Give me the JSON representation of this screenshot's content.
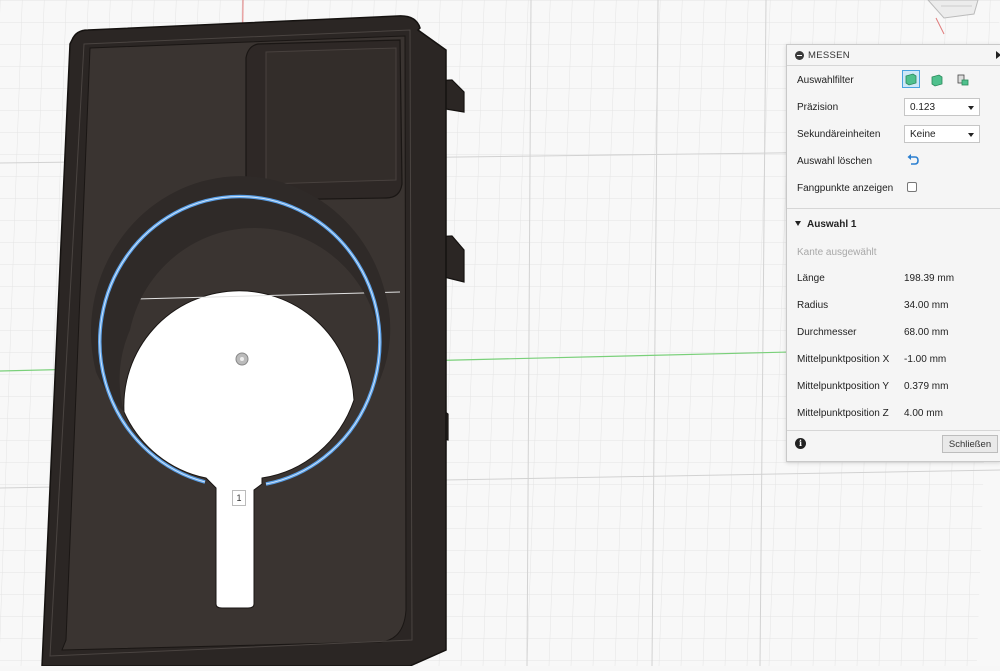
{
  "panel": {
    "title": "MESSEN",
    "filter_label": "Auswahlfilter",
    "precision_label": "Präzision",
    "precision_value": "0.123",
    "secondary_units_label": "Sekundäreinheiten",
    "secondary_units_value": "Keine",
    "clear_selection_label": "Auswahl löschen",
    "show_snap_points_label": "Fangpunkte anzeigen",
    "section_title": "Auswahl 1",
    "selected_info": "Kante ausgewählt",
    "measurements": [
      {
        "label": "Länge",
        "value": "198.39 mm"
      },
      {
        "label": "Radius",
        "value": "34.00 mm"
      },
      {
        "label": "Durchmesser",
        "value": "68.00 mm"
      },
      {
        "label": "Mittelpunktposition X",
        "value": "-1.00 mm"
      },
      {
        "label": "Mittelpunktposition Y",
        "value": "0.379 mm"
      },
      {
        "label": "Mittelpunktposition Z",
        "value": "4.00 mm"
      }
    ],
    "close_button": "Schließen",
    "info_icon": "i"
  },
  "viewport": {
    "point_label": "1",
    "axis_x_color": "#7ad07a",
    "axis_y_color": "#e07a7a",
    "selection_color": "#5aa0e8",
    "body_color": "#2b2624"
  },
  "icons": {
    "filter_body": "body-filter-icon",
    "filter_face": "face-filter-icon",
    "filter_edge": "edge-filter-icon",
    "undo": "undo-icon",
    "info": "info-icon"
  }
}
